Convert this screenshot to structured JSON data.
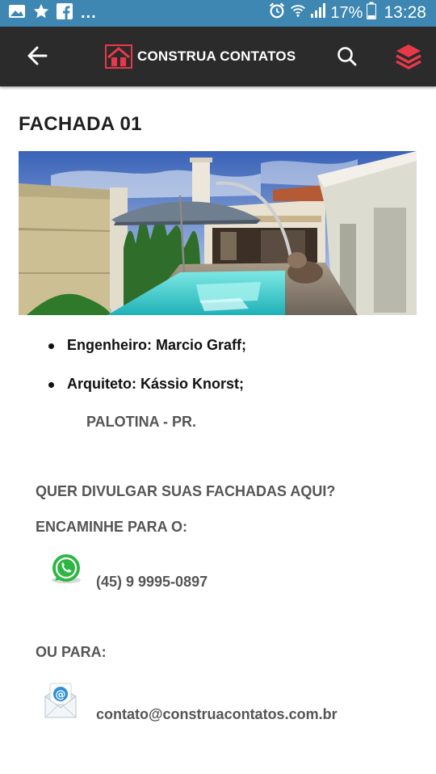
{
  "status_bar": {
    "more": "...",
    "battery": "17%",
    "time": "13:28"
  },
  "app_bar": {
    "logo_text": "CONSTRUA CONTATOS"
  },
  "content": {
    "title": "FACHADA 01",
    "credits": [
      "Engenheiro: Marcio Graff;",
      "Arquiteto: Kássio Knorst;"
    ],
    "location": "PALOTINA - PR.",
    "promo_question": "QUER DIVULGAR SUAS FACHADAS AQUI?",
    "promo_forward": "ENCAMINHE PARA O:",
    "phone": "(45) 9 9995-0897",
    "or_to": "OU PARA:",
    "email": "contato@construacontatos.com.br"
  },
  "colors": {
    "status_bar": "#3d87b2",
    "app_bar": "#2b2b2b",
    "accent_red": "#e8394a",
    "whatsapp_green": "#2db742"
  },
  "icons": {
    "status_left": [
      "gallery-icon",
      "star-icon",
      "facebook-icon"
    ],
    "status_right": [
      "alarm-icon",
      "wifi-icon",
      "signal-icon",
      "battery-icon"
    ],
    "app_bar": [
      "back-arrow-icon",
      "search-icon",
      "layers-icon"
    ],
    "contact": [
      "whatsapp-icon",
      "email-icon"
    ]
  }
}
